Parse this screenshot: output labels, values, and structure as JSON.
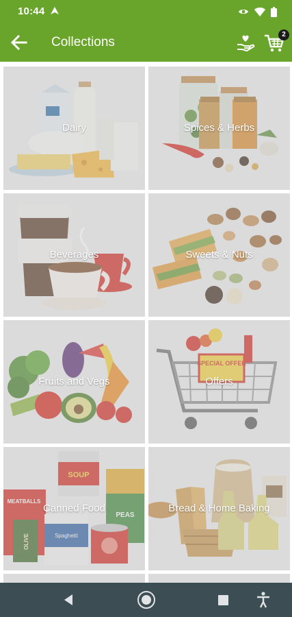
{
  "status_bar": {
    "time": "10:44"
  },
  "app_bar": {
    "title": "Collections",
    "cart_count": "2"
  },
  "collections": [
    {
      "label": "Dairy"
    },
    {
      "label": "Spices & Herbs"
    },
    {
      "label": "Beverages"
    },
    {
      "label": "Sweets & Nuts"
    },
    {
      "label": "Fruits and Vegs"
    },
    {
      "label": "Offers"
    },
    {
      "label": "Canned Food"
    },
    {
      "label": "Bread & Home Baking"
    }
  ],
  "artwork_text": {
    "offer_sign": "SPECIAL OFFER",
    "can_brand": "SOUP",
    "can_peas": "PEAS",
    "can_olive": "OLIVE",
    "can_spaghetti": "Spaghetti",
    "can_meatballs": "MEATBALLS"
  },
  "colors": {
    "brand_green": "#69a52a",
    "nav_bar": "#3d4d54",
    "tile_bg": "#ececec"
  }
}
